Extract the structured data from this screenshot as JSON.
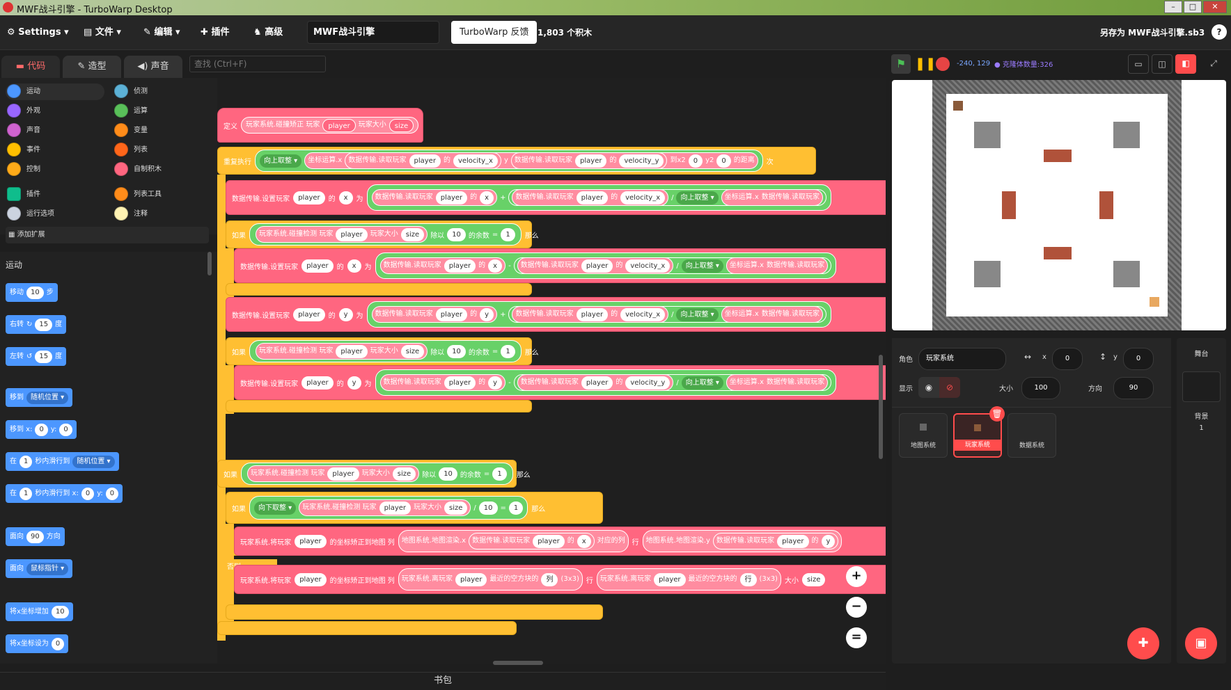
{
  "window": {
    "title": "MWF战斗引擎 - TurboWarp Desktop"
  },
  "menubar": {
    "settings": "Settings",
    "file": "文件",
    "edit": "编辑",
    "addons": "插件",
    "advanced": "高级",
    "project_title": "MWF战斗引擎",
    "feedback": "TurboWarp 反馈",
    "block_count": "1,803 个积木",
    "save_as": "另存为 MWF战斗引擎.sb3",
    "help": "?"
  },
  "tabs": {
    "code": "代码",
    "costumes": "造型",
    "sounds": "声音"
  },
  "search": {
    "placeholder": "查找 (Ctrl+F)"
  },
  "categories": {
    "left": [
      {
        "label": "运动",
        "color": "#4c97ff"
      },
      {
        "label": "外观",
        "color": "#9966ff"
      },
      {
        "label": "声音",
        "color": "#cf63cf"
      },
      {
        "label": "事件",
        "color": "#ffbf00"
      },
      {
        "label": "控制",
        "color": "#ffab19"
      },
      {
        "label": "插件",
        "color": "#0fbd8c"
      },
      {
        "label": "运行选项",
        "color": "#ccd3e0"
      }
    ],
    "right": [
      {
        "label": "侦测",
        "color": "#5cb1d6"
      },
      {
        "label": "运算",
        "color": "#59c059"
      },
      {
        "label": "变量",
        "color": "#ff8c1a"
      },
      {
        "label": "列表",
        "color": "#ff661a"
      },
      {
        "label": "自制积木",
        "color": "#ff6680"
      },
      {
        "label": "列表工具",
        "color": "#ff8c1a"
      },
      {
        "label": "注释",
        "color": "#fff3b3"
      }
    ],
    "add_extension": "添加扩展"
  },
  "palette": {
    "section": "运动",
    "move": {
      "a": "移动",
      "n": "10",
      "b": "步"
    },
    "turn_right": {
      "a": "右转",
      "n": "15",
      "b": "度"
    },
    "turn_left": {
      "a": "左转",
      "n": "15",
      "b": "度"
    },
    "goto": {
      "a": "移到",
      "dd": "随机位置"
    },
    "goto_xy": {
      "a": "移到 x:",
      "x": "0",
      "b": "y:",
      "y": "0"
    },
    "glide": {
      "a": "在",
      "n": "1",
      "b": "秒内滑行到",
      "dd": "随机位置"
    },
    "glide_xy": {
      "a": "在",
      "n": "1",
      "b": "秒内滑行到 x:",
      "x": "0",
      "c": "y:",
      "y": "0"
    },
    "point": {
      "a": "面向",
      "n": "90",
      "b": "方向"
    },
    "point_towards": {
      "a": "面向",
      "dd": "鼠标指针"
    },
    "change_x": {
      "a": "将x坐标增加",
      "n": "10"
    },
    "set_x": {
      "a": "将x坐标设为",
      "n": "0"
    }
  },
  "script": {
    "define": {
      "kw": "定义",
      "name": "玩家系统.碰撞矫正 玩家",
      "p1": "player",
      "mid": "玩家大小",
      "p2": "size"
    },
    "repeat": {
      "kw": "重复执行",
      "round": "向上取整",
      "op": "坐标运算.x",
      "read": "数据传输.读取玩家",
      "p": "player",
      "of": "的",
      "vx": "velocity_x",
      "y": "y",
      "vy": "velocity_y",
      "to": "到x2",
      "n1": "0",
      "y2": "y2",
      "n2": "0",
      "dist": "的距离",
      "times": "次"
    },
    "set_x": {
      "a": "数据传输.设置玩家",
      "p": "player",
      "of": "的",
      "key": "x",
      "as": "为",
      "plus": "+",
      "div": "/"
    },
    "set_y": {
      "key": "y",
      "minus": "-"
    },
    "if1": {
      "kw": "如果",
      "detect": "玩家系统.碰撞检测 玩家",
      "size_label": "玩家大小",
      "size": "size",
      "mod": "除以",
      "ten": "10",
      "rem": "的余数",
      "eq": "=",
      "one": "1",
      "then": "那么"
    },
    "if_down": {
      "round": "向下取整",
      "slash": "/"
    },
    "snap": {
      "a": "玩家系统.将玩家",
      "p": "player",
      "b": "的坐标矫正到地图 列",
      "map": "地图系统.地图渲染.x",
      "col": "对应的列",
      "row": "行",
      "mapy": "地图系统.地图渲染.y"
    },
    "else": {
      "kw": "否则"
    },
    "snap2": {
      "near": "玩家系统.离玩家",
      "near_b": "最近的空方块的",
      "col": "列",
      "row": "行",
      "three": "(3x3)",
      "size_l": "大小",
      "size": "size"
    }
  },
  "backpack": "书包",
  "stage_toolbar": {
    "coords": "-240, 129",
    "clones": "克隆体数量:326"
  },
  "sprite_info": {
    "sprite_label": "角色",
    "sprite_name": "玩家系统",
    "x_label": "x",
    "x": "0",
    "y_label": "y",
    "y": "0",
    "show_label": "显示",
    "size_label": "大小",
    "size": "100",
    "dir_label": "方向",
    "dir": "90"
  },
  "sprites": [
    {
      "name": "地图系统"
    },
    {
      "name": "玩家系统"
    },
    {
      "name": "数据系统"
    }
  ],
  "stage_panel": {
    "title": "舞台",
    "backdrop_label": "背景",
    "backdrop_count": "1"
  },
  "zoom": {
    "in": "+",
    "out": "−",
    "reset": "="
  },
  "colors": {
    "accent": "#ff4c4c",
    "motion": "#4c97ff",
    "custom": "#ff6680",
    "control": "#ffbf32",
    "operator": "#59c059"
  }
}
